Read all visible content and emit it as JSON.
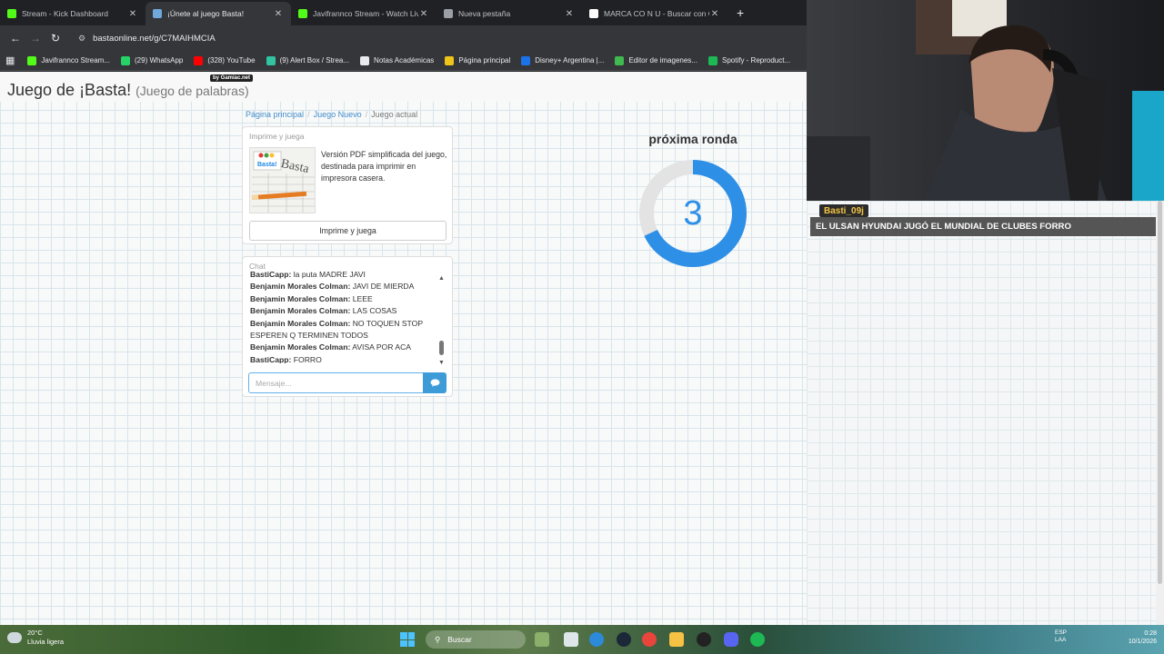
{
  "browser": {
    "tabs": [
      {
        "title": "Stream - Kick Dashboard",
        "icon": "kick-icon",
        "color": "#53fc18",
        "active": false
      },
      {
        "title": "¡Únete al juego Basta!",
        "icon": "basta-icon",
        "color": "#6fa8dc",
        "active": true
      },
      {
        "title": "Javifrannco Stream - Watch Live",
        "icon": "kick-icon",
        "color": "#53fc18",
        "active": false
      },
      {
        "title": "Nueva pestaña",
        "icon": "chrome-icon",
        "color": "#9aa0a6",
        "active": false
      },
      {
        "title": "MARCA CO N U - Buscar con G",
        "icon": "google-icon",
        "color": "#ffffff",
        "active": false
      }
    ],
    "new_tab_label": "+",
    "url": "bastaonline.net/g/C7MAIHMCIA",
    "bookmarks": [
      {
        "label": "Javifrannco Stream...",
        "icon": "kick-icon",
        "color": "#53fc18"
      },
      {
        "label": "(29) WhatsApp",
        "icon": "whatsapp-icon",
        "color": "#25d366"
      },
      {
        "label": "(328) YouTube",
        "icon": "youtube-icon",
        "color": "#ff0000"
      },
      {
        "label": "(9) Alert Box / Strea...",
        "icon": "streamlabs-icon",
        "color": "#31c3a2"
      },
      {
        "label": "Notas Académicas",
        "icon": "page-icon",
        "color": "#e8eaed"
      },
      {
        "label": "Página principal",
        "icon": "home-icon",
        "color": "#f0c419"
      },
      {
        "label": "Disney+ Argentina |...",
        "icon": "disney-icon",
        "color": "#1a73e8"
      },
      {
        "label": "Editor de imagenes...",
        "icon": "editor-icon",
        "color": "#3fb950"
      },
      {
        "label": "Spotify - Reproduct...",
        "icon": "spotify-icon",
        "color": "#1db954"
      }
    ]
  },
  "site": {
    "title": "Juego de ¡Basta!",
    "subtitle": "(Juego de palabras)",
    "badge": "by Gamiac.net",
    "breadcrumb": [
      "Página principal",
      "Juego Nuevo",
      "Juego actual"
    ]
  },
  "print_panel": {
    "heading": "Imprime y juega",
    "description": "Versión PDF simplificada del juego, destinada para imprimir en impresora casera.",
    "button_label": "Imprime y juega",
    "thumb_text": "Basta!"
  },
  "chat": {
    "heading": "Chat",
    "messages": [
      {
        "author": "BastiCapp:",
        "text": " la puta MADRE JAVI"
      },
      {
        "author": "Benjamin Morales Colman:",
        "text": " JAVI DE MIERDA"
      },
      {
        "author": "Benjamin Morales Colman:",
        "text": " LEEE"
      },
      {
        "author": "Benjamin Morales Colman:",
        "text": " LAS COSAS"
      },
      {
        "author": "Benjamin Morales Colman:",
        "text": " NO TOQUEN STOP ESPEREN Q TERMINEN TODOS"
      },
      {
        "author": "Benjamin Morales Colman:",
        "text": " AVISA POR ACA"
      },
      {
        "author": "BastiCapp:",
        "text": " FORRO"
      }
    ],
    "input_placeholder": "Mensaje..."
  },
  "round": {
    "label": "próxima ronda",
    "countdown": "3",
    "progress_fraction": 0.68,
    "accent_color": "#2e8fe6"
  },
  "stream_overlay": {
    "username": "Basti_09j",
    "message": "EL ULSAN HYUNDAI JUGÓ EL MUNDIAL DE CLUBES FORRO"
  },
  "taskbar": {
    "weather_temp": "20°C",
    "weather_desc": "Lluvia ligera",
    "search_placeholder": "Buscar",
    "lang_line1": "ESP",
    "lang_line2": "LAA",
    "time": "0:28",
    "date": "10/1/2026"
  }
}
